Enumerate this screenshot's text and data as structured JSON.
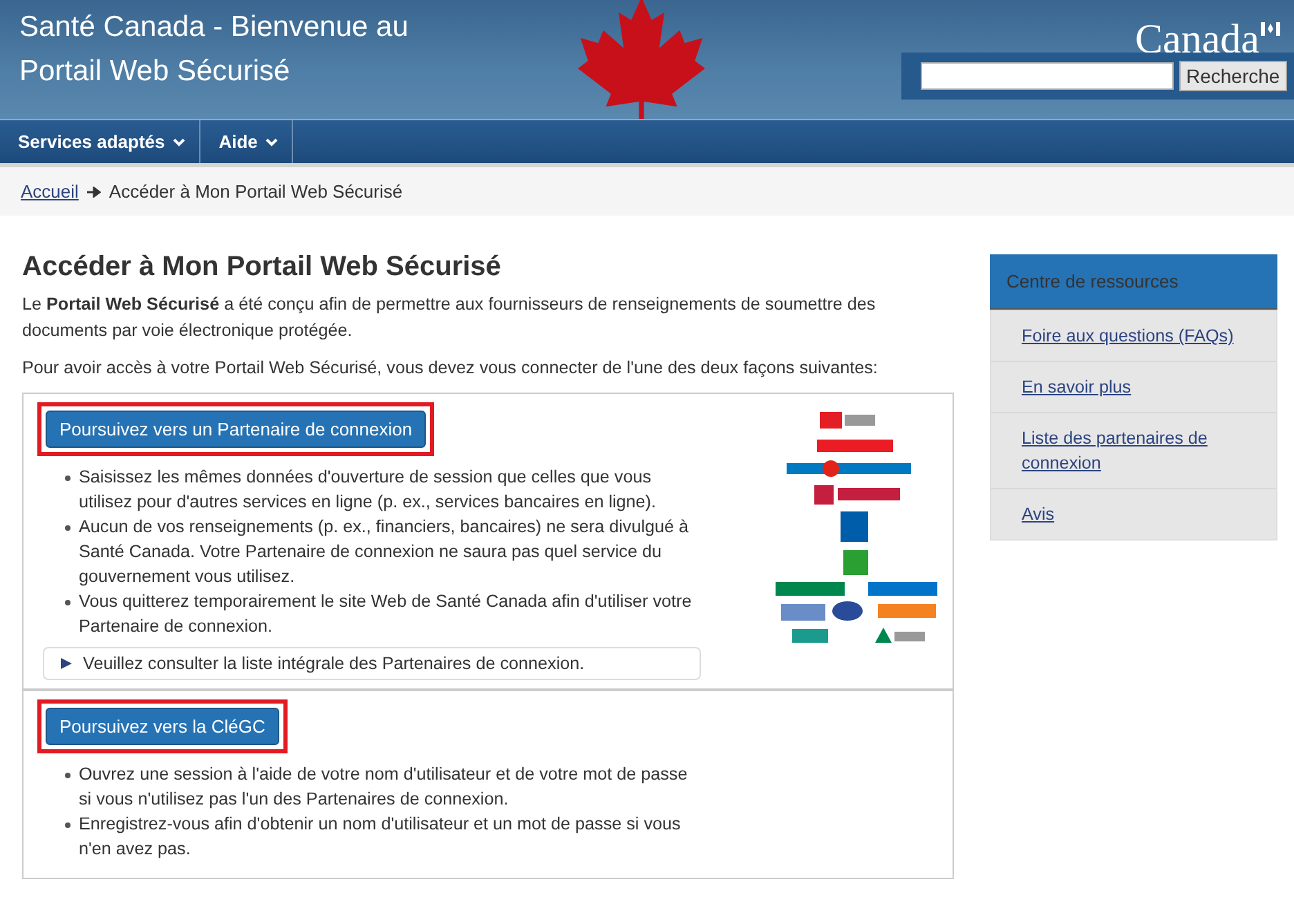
{
  "header": {
    "title_lines": [
      "Santé Canada - Bienvenue au",
      "Portail Web Sécurisé"
    ],
    "wordmark": "Canada",
    "search": {
      "button": "Recherche"
    }
  },
  "nav": [
    {
      "label": "Services adaptés"
    },
    {
      "label": "Aide"
    }
  ],
  "breadcrumb": {
    "home": "Accueil",
    "current": "Accéder à Mon Portail Web Sécurisé"
  },
  "main": {
    "heading": "Accéder à Mon Portail Web Sécurisé",
    "intro": "Le **Portail Web Sécurisé** a été conçu afin de permettre aux fournisseurs de renseignements de soumettre des documents par voie électronique protégée.",
    "instruction": "Pour avoir accès à votre Portail Web Sécurisé, vous devez vous connecter de l'une des deux façons suivantes:",
    "options": [
      {
        "button": "Poursuivez vers un Partenaire de connexion",
        "highlighted": true,
        "partner_logos": {
          "kind": "picture"
        },
        "bullets": [
          "Saisissez les mêmes données d'ouverture de session que celles que vous utilisez pour d'autres services en ligne (p. ex., services bancaires en ligne).",
          "Aucun de vos renseignements (p. ex., financiers, bancaires) ne sera divulgué à Santé Canada. Votre Partenaire de connexion ne saura pas quel service du gouvernement vous utilisez.",
          "Vous quitterez temporairement le site Web de Santé Canada afin d'utiliser votre Partenaire de connexion."
        ],
        "details": {
          "label": "Veuillez consulter la liste intégrale des Partenaires de connexion.",
          "expanded": false
        }
      },
      {
        "button": "Poursuivez vers la CléGC",
        "highlighted": true,
        "bullets": [
          "Ouvrez une session à l'aide de votre nom d'utilisateur et de votre mot de passe si vous n'utilisez pas l'un des Partenaires de connexion.",
          "Enregistrez-vous afin d'obtenir un nom d'utilisateur et un mot de passe si vous n'en avez pas."
        ]
      }
    ]
  },
  "sidebar": {
    "title": "Centre de ressources",
    "links": [
      "Foire aux questions (FAQs)",
      "En savoir plus",
      "Liste des partenaires de connexion",
      "Avis"
    ]
  }
}
